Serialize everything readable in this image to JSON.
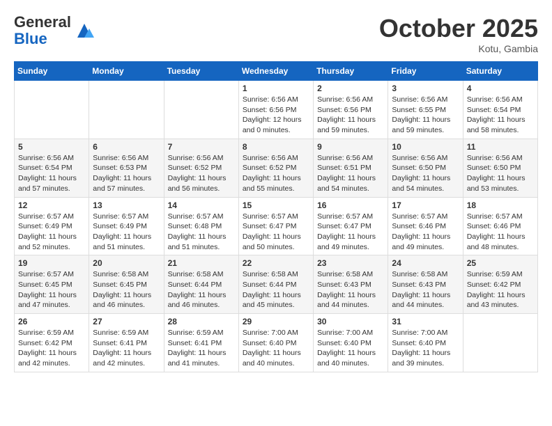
{
  "header": {
    "logo_line1": "General",
    "logo_line2": "Blue",
    "month": "October 2025",
    "location": "Kotu, Gambia"
  },
  "weekdays": [
    "Sunday",
    "Monday",
    "Tuesday",
    "Wednesday",
    "Thursday",
    "Friday",
    "Saturday"
  ],
  "weeks": [
    [
      {
        "day": "",
        "info": ""
      },
      {
        "day": "",
        "info": ""
      },
      {
        "day": "",
        "info": ""
      },
      {
        "day": "1",
        "info": "Sunrise: 6:56 AM\nSunset: 6:56 PM\nDaylight: 12 hours\nand 0 minutes."
      },
      {
        "day": "2",
        "info": "Sunrise: 6:56 AM\nSunset: 6:56 PM\nDaylight: 11 hours\nand 59 minutes."
      },
      {
        "day": "3",
        "info": "Sunrise: 6:56 AM\nSunset: 6:55 PM\nDaylight: 11 hours\nand 59 minutes."
      },
      {
        "day": "4",
        "info": "Sunrise: 6:56 AM\nSunset: 6:54 PM\nDaylight: 11 hours\nand 58 minutes."
      }
    ],
    [
      {
        "day": "5",
        "info": "Sunrise: 6:56 AM\nSunset: 6:54 PM\nDaylight: 11 hours\nand 57 minutes."
      },
      {
        "day": "6",
        "info": "Sunrise: 6:56 AM\nSunset: 6:53 PM\nDaylight: 11 hours\nand 57 minutes."
      },
      {
        "day": "7",
        "info": "Sunrise: 6:56 AM\nSunset: 6:52 PM\nDaylight: 11 hours\nand 56 minutes."
      },
      {
        "day": "8",
        "info": "Sunrise: 6:56 AM\nSunset: 6:52 PM\nDaylight: 11 hours\nand 55 minutes."
      },
      {
        "day": "9",
        "info": "Sunrise: 6:56 AM\nSunset: 6:51 PM\nDaylight: 11 hours\nand 54 minutes."
      },
      {
        "day": "10",
        "info": "Sunrise: 6:56 AM\nSunset: 6:50 PM\nDaylight: 11 hours\nand 54 minutes."
      },
      {
        "day": "11",
        "info": "Sunrise: 6:56 AM\nSunset: 6:50 PM\nDaylight: 11 hours\nand 53 minutes."
      }
    ],
    [
      {
        "day": "12",
        "info": "Sunrise: 6:57 AM\nSunset: 6:49 PM\nDaylight: 11 hours\nand 52 minutes."
      },
      {
        "day": "13",
        "info": "Sunrise: 6:57 AM\nSunset: 6:49 PM\nDaylight: 11 hours\nand 51 minutes."
      },
      {
        "day": "14",
        "info": "Sunrise: 6:57 AM\nSunset: 6:48 PM\nDaylight: 11 hours\nand 51 minutes."
      },
      {
        "day": "15",
        "info": "Sunrise: 6:57 AM\nSunset: 6:47 PM\nDaylight: 11 hours\nand 50 minutes."
      },
      {
        "day": "16",
        "info": "Sunrise: 6:57 AM\nSunset: 6:47 PM\nDaylight: 11 hours\nand 49 minutes."
      },
      {
        "day": "17",
        "info": "Sunrise: 6:57 AM\nSunset: 6:46 PM\nDaylight: 11 hours\nand 49 minutes."
      },
      {
        "day": "18",
        "info": "Sunrise: 6:57 AM\nSunset: 6:46 PM\nDaylight: 11 hours\nand 48 minutes."
      }
    ],
    [
      {
        "day": "19",
        "info": "Sunrise: 6:57 AM\nSunset: 6:45 PM\nDaylight: 11 hours\nand 47 minutes."
      },
      {
        "day": "20",
        "info": "Sunrise: 6:58 AM\nSunset: 6:45 PM\nDaylight: 11 hours\nand 46 minutes."
      },
      {
        "day": "21",
        "info": "Sunrise: 6:58 AM\nSunset: 6:44 PM\nDaylight: 11 hours\nand 46 minutes."
      },
      {
        "day": "22",
        "info": "Sunrise: 6:58 AM\nSunset: 6:44 PM\nDaylight: 11 hours\nand 45 minutes."
      },
      {
        "day": "23",
        "info": "Sunrise: 6:58 AM\nSunset: 6:43 PM\nDaylight: 11 hours\nand 44 minutes."
      },
      {
        "day": "24",
        "info": "Sunrise: 6:58 AM\nSunset: 6:43 PM\nDaylight: 11 hours\nand 44 minutes."
      },
      {
        "day": "25",
        "info": "Sunrise: 6:59 AM\nSunset: 6:42 PM\nDaylight: 11 hours\nand 43 minutes."
      }
    ],
    [
      {
        "day": "26",
        "info": "Sunrise: 6:59 AM\nSunset: 6:42 PM\nDaylight: 11 hours\nand 42 minutes."
      },
      {
        "day": "27",
        "info": "Sunrise: 6:59 AM\nSunset: 6:41 PM\nDaylight: 11 hours\nand 42 minutes."
      },
      {
        "day": "28",
        "info": "Sunrise: 6:59 AM\nSunset: 6:41 PM\nDaylight: 11 hours\nand 41 minutes."
      },
      {
        "day": "29",
        "info": "Sunrise: 7:00 AM\nSunset: 6:40 PM\nDaylight: 11 hours\nand 40 minutes."
      },
      {
        "day": "30",
        "info": "Sunrise: 7:00 AM\nSunset: 6:40 PM\nDaylight: 11 hours\nand 40 minutes."
      },
      {
        "day": "31",
        "info": "Sunrise: 7:00 AM\nSunset: 6:40 PM\nDaylight: 11 hours\nand 39 minutes."
      },
      {
        "day": "",
        "info": ""
      }
    ]
  ]
}
